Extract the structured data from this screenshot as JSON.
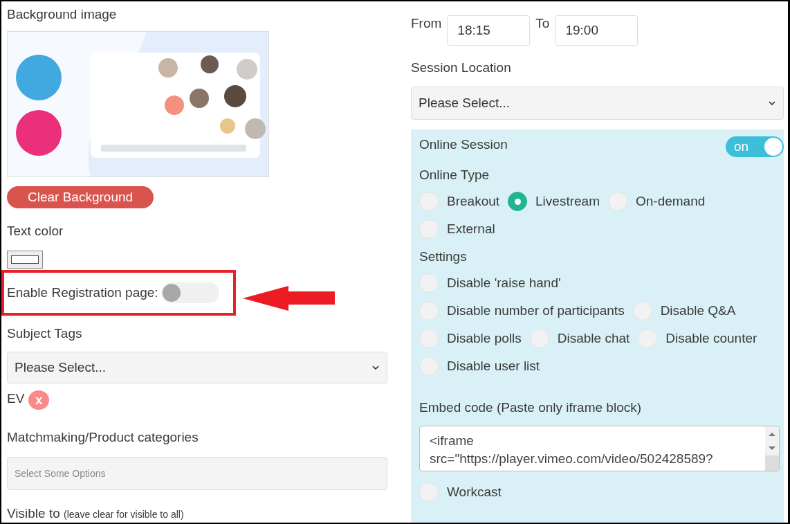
{
  "left": {
    "background_label": "Background image",
    "clear_button": "Clear Background",
    "text_color_label": "Text color",
    "registration": {
      "label": "Enable Registration page:",
      "on": false
    },
    "subject_tags": {
      "label": "Subject Tags",
      "value": "Please Select..."
    },
    "tags": [
      {
        "label": "EV",
        "remove": "x"
      }
    ],
    "matchmaking": {
      "label": "Matchmaking/Product categories",
      "placeholder": "Select Some Options"
    },
    "visible_to": {
      "label": "Visible to",
      "hint": "(leave clear for visible to all)"
    }
  },
  "right": {
    "from_label": "From",
    "from_value": "18:15",
    "to_label": "To",
    "to_value": "19:00",
    "location": {
      "label": "Session Location",
      "value": "Please Select..."
    },
    "online_session": {
      "label": "Online Session",
      "on": true,
      "toggle_text": "on",
      "type_label": "Online Type",
      "type_rows": [
        [
          {
            "label": "Breakout",
            "selected": false
          },
          {
            "label": "Livestream",
            "selected": true
          },
          {
            "label": "On-demand",
            "selected": false
          }
        ],
        [
          {
            "label": "External",
            "selected": false
          }
        ]
      ],
      "settings_label": "Settings",
      "settings_rows": [
        [
          {
            "label": "Disable 'raise hand'",
            "checked": false
          }
        ],
        [
          {
            "label": "Disable number of participants",
            "checked": false
          },
          {
            "label": "Disable Q&A",
            "checked": false
          }
        ],
        [
          {
            "label": "Disable polls",
            "checked": false
          },
          {
            "label": "Disable chat",
            "checked": false
          },
          {
            "label": "Disable counter",
            "checked": false
          }
        ],
        [
          {
            "label": "Disable user list",
            "checked": false
          }
        ]
      ],
      "embed_label": "Embed code (Paste only iframe block)",
      "embed_value": "<iframe src=\"https://player.vimeo.com/video/502428589?",
      "workcast": {
        "label": "Workcast",
        "checked": false
      }
    }
  }
}
